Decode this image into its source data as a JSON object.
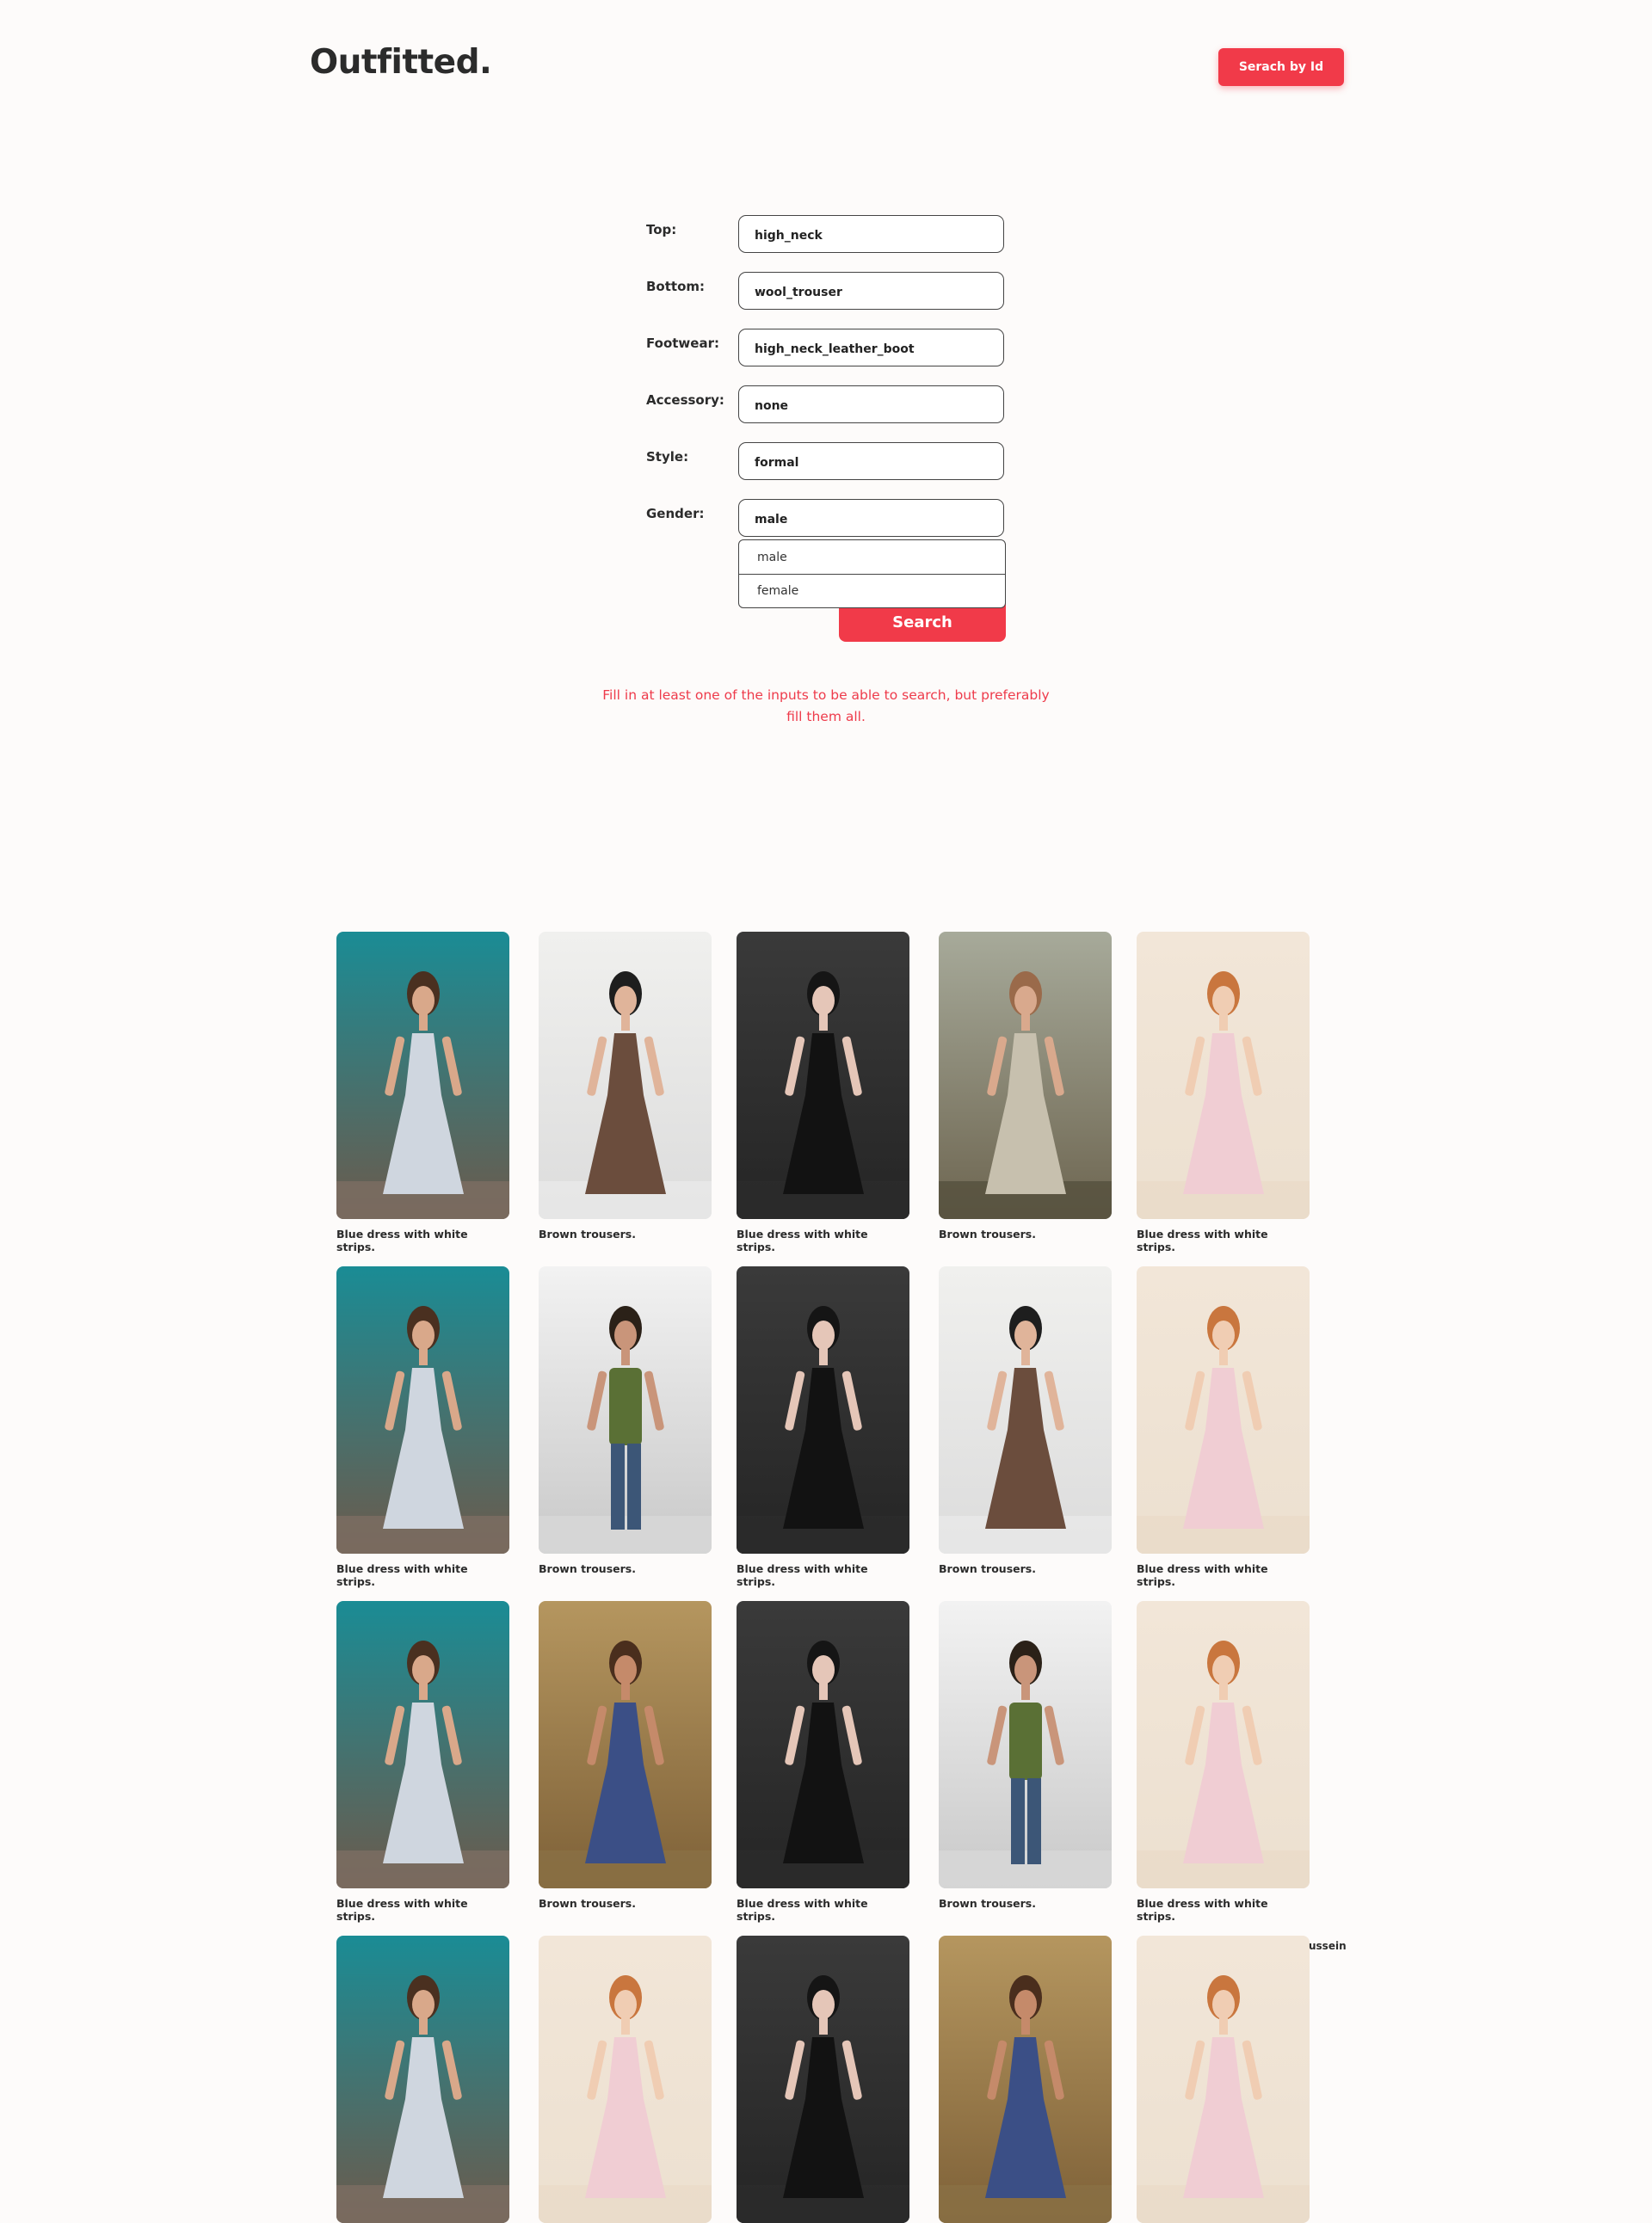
{
  "header": {
    "logo": "Outfitted.",
    "search_by_id_label": "Serach by Id"
  },
  "form": {
    "fields": [
      {
        "label": "Top:",
        "value": "high_neck"
      },
      {
        "label": "Bottom:",
        "value": "wool_trouser"
      },
      {
        "label": "Footwear:",
        "value": "high_neck_leather_boot"
      },
      {
        "label": "Accessory:",
        "value": "none"
      },
      {
        "label": "Style:",
        "value": "formal"
      },
      {
        "label": "Gender:",
        "value": "male"
      }
    ],
    "gender_options": [
      "male",
      "female"
    ],
    "search_label": "Search",
    "hint": "Fill in at least one of the inputs to be able to search, but preferably fill them all."
  },
  "gallery": {
    "captions": {
      "blue": "Blue dress with white strips.",
      "brown": "Brown trousers."
    },
    "stray_text": "ussein"
  },
  "colors": {
    "accent": "#f13a49",
    "hint": "#ee3b4b",
    "background": "#fdfbfa"
  }
}
